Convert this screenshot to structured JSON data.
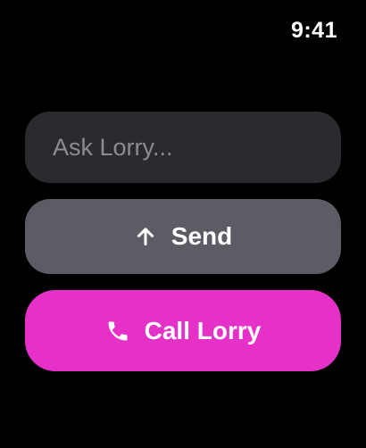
{
  "status_bar": {
    "time": "9:41"
  },
  "ask_input": {
    "placeholder": "Ask Lorry...",
    "value": ""
  },
  "send_button": {
    "label": "Send",
    "icon": "arrow-up-icon"
  },
  "call_button": {
    "label": "Call Lorry",
    "icon": "phone-icon"
  },
  "colors": {
    "background": "#000000",
    "input_bg": "#2b2b2f",
    "send_bg": "#5c5d64",
    "call_bg": "#e531c8",
    "placeholder": "#8c8c92"
  }
}
